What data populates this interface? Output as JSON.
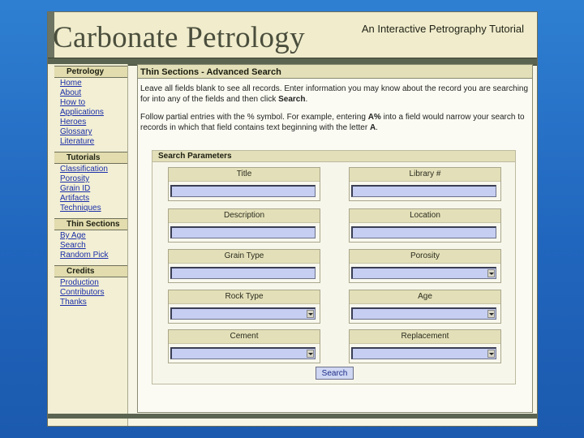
{
  "header": {
    "title": "Carbonate Petrology",
    "subtitle": "An Interactive Petrography Tutorial"
  },
  "sidebar": {
    "sections": [
      {
        "title": "Petrology",
        "links": [
          "Home",
          "About",
          "How to",
          "Applications",
          "Heroes",
          "Glossary",
          "Literature"
        ]
      },
      {
        "title": "Tutorials",
        "links": [
          "Classification",
          "Porosity",
          "Grain ID",
          "Artifacts",
          "Techniques"
        ]
      },
      {
        "title": "Thin Sections",
        "links": [
          "By Age",
          "Search",
          "Random Pick"
        ]
      },
      {
        "title": "Credits",
        "links": [
          "Production",
          "Contributors",
          "Thanks"
        ]
      }
    ]
  },
  "main": {
    "title": "Thin Sections - Advanced Search",
    "intro_1a": "Leave all fields blank to see all records. Enter information you may know about the record you are searching for into any of the fields and then click ",
    "intro_1b": "Search",
    "intro_1c": ".",
    "intro_2a": "Follow partial entries with the % symbol. For example, entering ",
    "intro_2b": "A%",
    "intro_2c": " into a field would narrow your search to records in which that field contains text beginning with the letter ",
    "intro_2d": "A",
    "intro_2e": "."
  },
  "form": {
    "legend": "Search Parameters",
    "fields": {
      "title": {
        "label": "Title",
        "value": ""
      },
      "library": {
        "label": "Library #",
        "value": ""
      },
      "description": {
        "label": "Description",
        "value": ""
      },
      "location": {
        "label": "Location",
        "value": ""
      },
      "grain_type": {
        "label": "Grain Type",
        "value": ""
      },
      "porosity": {
        "label": "Porosity",
        "value": ""
      },
      "rock_type": {
        "label": "Rock Type",
        "value": ""
      },
      "age": {
        "label": "Age",
        "value": ""
      },
      "cement": {
        "label": "Cement",
        "value": ""
      },
      "replacement": {
        "label": "Replacement",
        "value": ""
      }
    },
    "submit_label": "Search"
  },
  "colors": {
    "background": "#2166be",
    "panel": "#f6f5e6",
    "header_bar": "#e3dfb8",
    "input_fill": "#c6cff2",
    "link": "#1b2ea8"
  }
}
